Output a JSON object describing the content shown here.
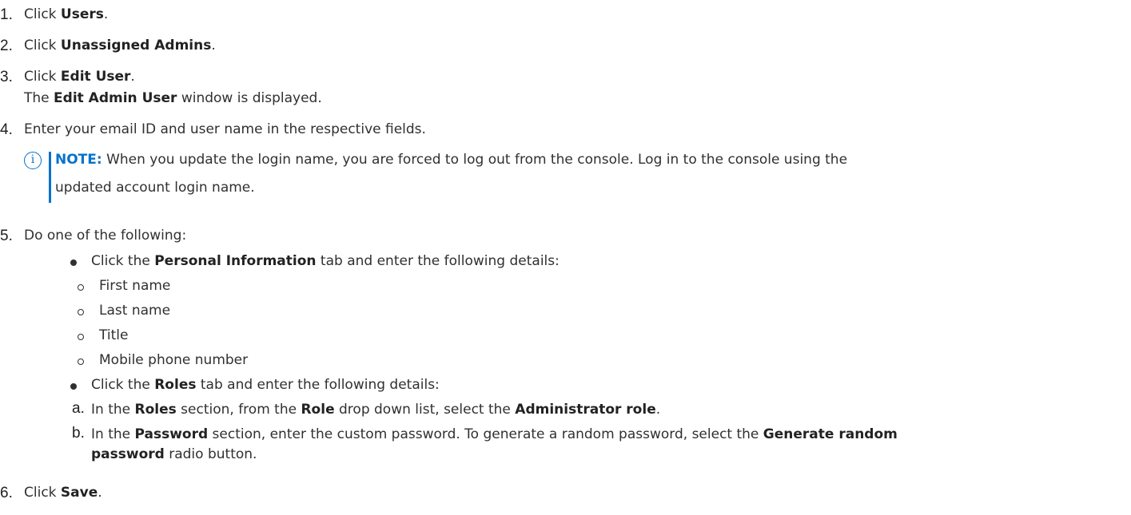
{
  "steps": {
    "s1": {
      "num": "1.",
      "pre": "Click ",
      "bold": "Users",
      "post": "."
    },
    "s2": {
      "num": "2.",
      "pre": "Click ",
      "bold": "Unassigned Admins",
      "post": "."
    },
    "s3": {
      "num": "3.",
      "pre": "Click ",
      "bold": "Edit User",
      "post": ".",
      "result_pre": "The ",
      "result_bold": "Edit Admin User",
      "result_post": " window is displayed."
    },
    "s4": {
      "num": "4.",
      "text": "Enter your email ID and user name in the respective fields."
    },
    "s5": {
      "num": "5.",
      "text": "Do one of the following:"
    },
    "s6": {
      "num": "6.",
      "pre": "Click ",
      "bold": "Save",
      "post": "."
    }
  },
  "note": {
    "icon": "info-icon",
    "label": "NOTE:",
    "line1": " When you update the login name, you are forced to log out from the console. Log in to the console using the",
    "line2": "updated account login name."
  },
  "options": {
    "personal": {
      "pre": "Click the ",
      "bold": "Personal Information",
      "post": " tab and enter the following details:",
      "fields": [
        "First name",
        "Last name",
        "Title",
        "Mobile phone number"
      ]
    },
    "roles": {
      "pre": "Click the ",
      "bold": "Roles",
      "post": " tab and enter the following details:",
      "a": {
        "letter": "a.",
        "pre1": "In the ",
        "bold1": "Roles",
        "pre2": " section, from the ",
        "bold2": "Role",
        "pre3": " drop down list, select the ",
        "bold3": "Administrator role",
        "post": "."
      },
      "b": {
        "letter": "b.",
        "pre1": "In the ",
        "bold1": "Password",
        "pre2": " section, enter the custom password. To generate a random password, select the ",
        "bold2": "Generate random",
        "line2_bold": "password",
        "line2_post": " radio button."
      }
    }
  },
  "colors": {
    "accent": "#0672cb",
    "text": "#303030"
  }
}
